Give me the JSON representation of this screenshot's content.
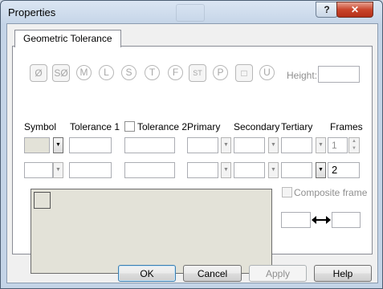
{
  "window": {
    "title": "Properties"
  },
  "titlebar": {
    "help_label": "?",
    "close_label": "✕"
  },
  "tab": {
    "label": "Geometric Tolerance"
  },
  "symbols": [
    {
      "name": "diameter-icon",
      "glyph": "Ø"
    },
    {
      "name": "spherical-diameter-icon",
      "glyph": "SØ"
    },
    {
      "name": "mmc-icon",
      "glyph": "M"
    },
    {
      "name": "lmc-icon",
      "glyph": "L"
    },
    {
      "name": "s-modifier-icon",
      "glyph": "S"
    },
    {
      "name": "tangent-plane-icon",
      "glyph": "T"
    },
    {
      "name": "free-state-icon",
      "glyph": "F"
    },
    {
      "name": "statistical-icon",
      "glyph": "ST"
    },
    {
      "name": "projected-zone-icon",
      "glyph": "P"
    },
    {
      "name": "square-icon",
      "glyph": "□"
    },
    {
      "name": "unequal-icon",
      "glyph": "U"
    }
  ],
  "height_label": "Height:",
  "headers": {
    "symbol": "Symbol",
    "tolerance1": "Tolerance 1",
    "tolerance2": "Tolerance 2",
    "primary": "Primary",
    "secondary": "Secondary",
    "tertiary": "Tertiary",
    "frames": "Frames"
  },
  "rows": [
    {
      "frames": "1"
    },
    {
      "frames": "2"
    }
  ],
  "composite_frame_label": "Composite frame",
  "buttons": {
    "ok": "OK",
    "cancel": "Cancel",
    "apply": "Apply",
    "help": "Help"
  }
}
